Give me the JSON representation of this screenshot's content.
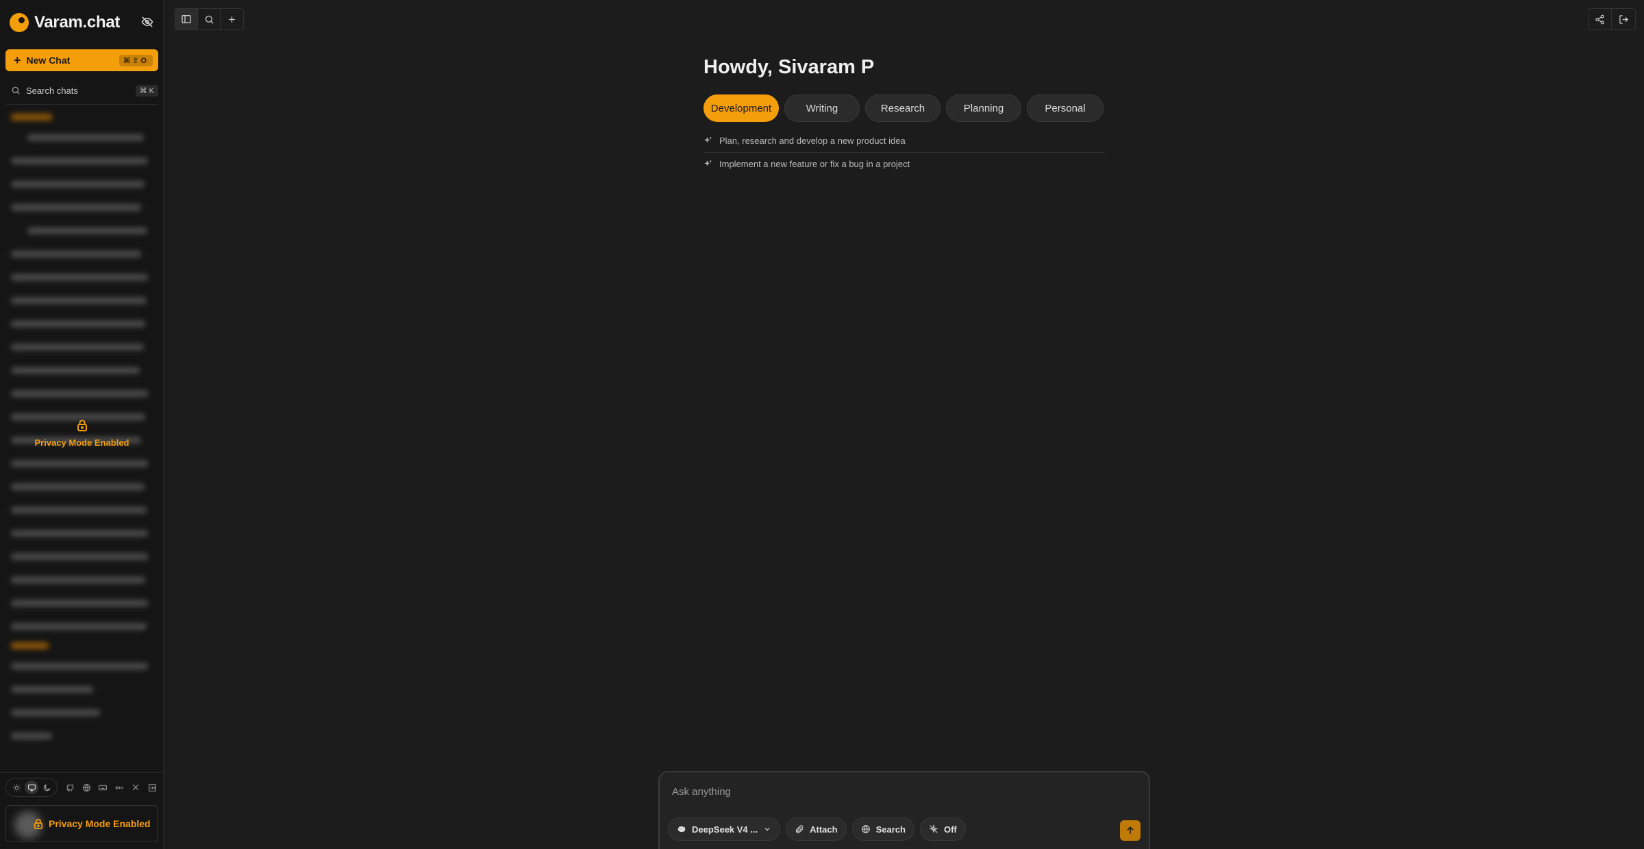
{
  "app": {
    "name": "Varam.chat"
  },
  "sidebar": {
    "new_chat_label": "New Chat",
    "new_chat_shortcut": "⌘⇧O",
    "search_label": "Search chats",
    "search_shortcut": "⌘ K",
    "privacy_center_label": "Privacy Mode Enabled",
    "privacy_footer_label": "Privacy Mode Enabled"
  },
  "main": {
    "greeting": "Howdy, Sivaram P",
    "tabs": [
      {
        "label": "Development",
        "active": true
      },
      {
        "label": "Writing",
        "active": false
      },
      {
        "label": "Research",
        "active": false
      },
      {
        "label": "Planning",
        "active": false
      },
      {
        "label": "Personal",
        "active": false
      }
    ],
    "suggestions": [
      "Plan, research and develop a new product idea",
      "Implement a new feature or fix a bug in a project"
    ]
  },
  "composer": {
    "placeholder": "Ask anything",
    "model_label": "DeepSeek V4 ...",
    "attach_label": "Attach",
    "search_label": "Search",
    "reasoning_label": "Off"
  },
  "colors": {
    "accent": "#f59e0b",
    "background": "#1c1c1c",
    "sidebar": "#151515"
  }
}
